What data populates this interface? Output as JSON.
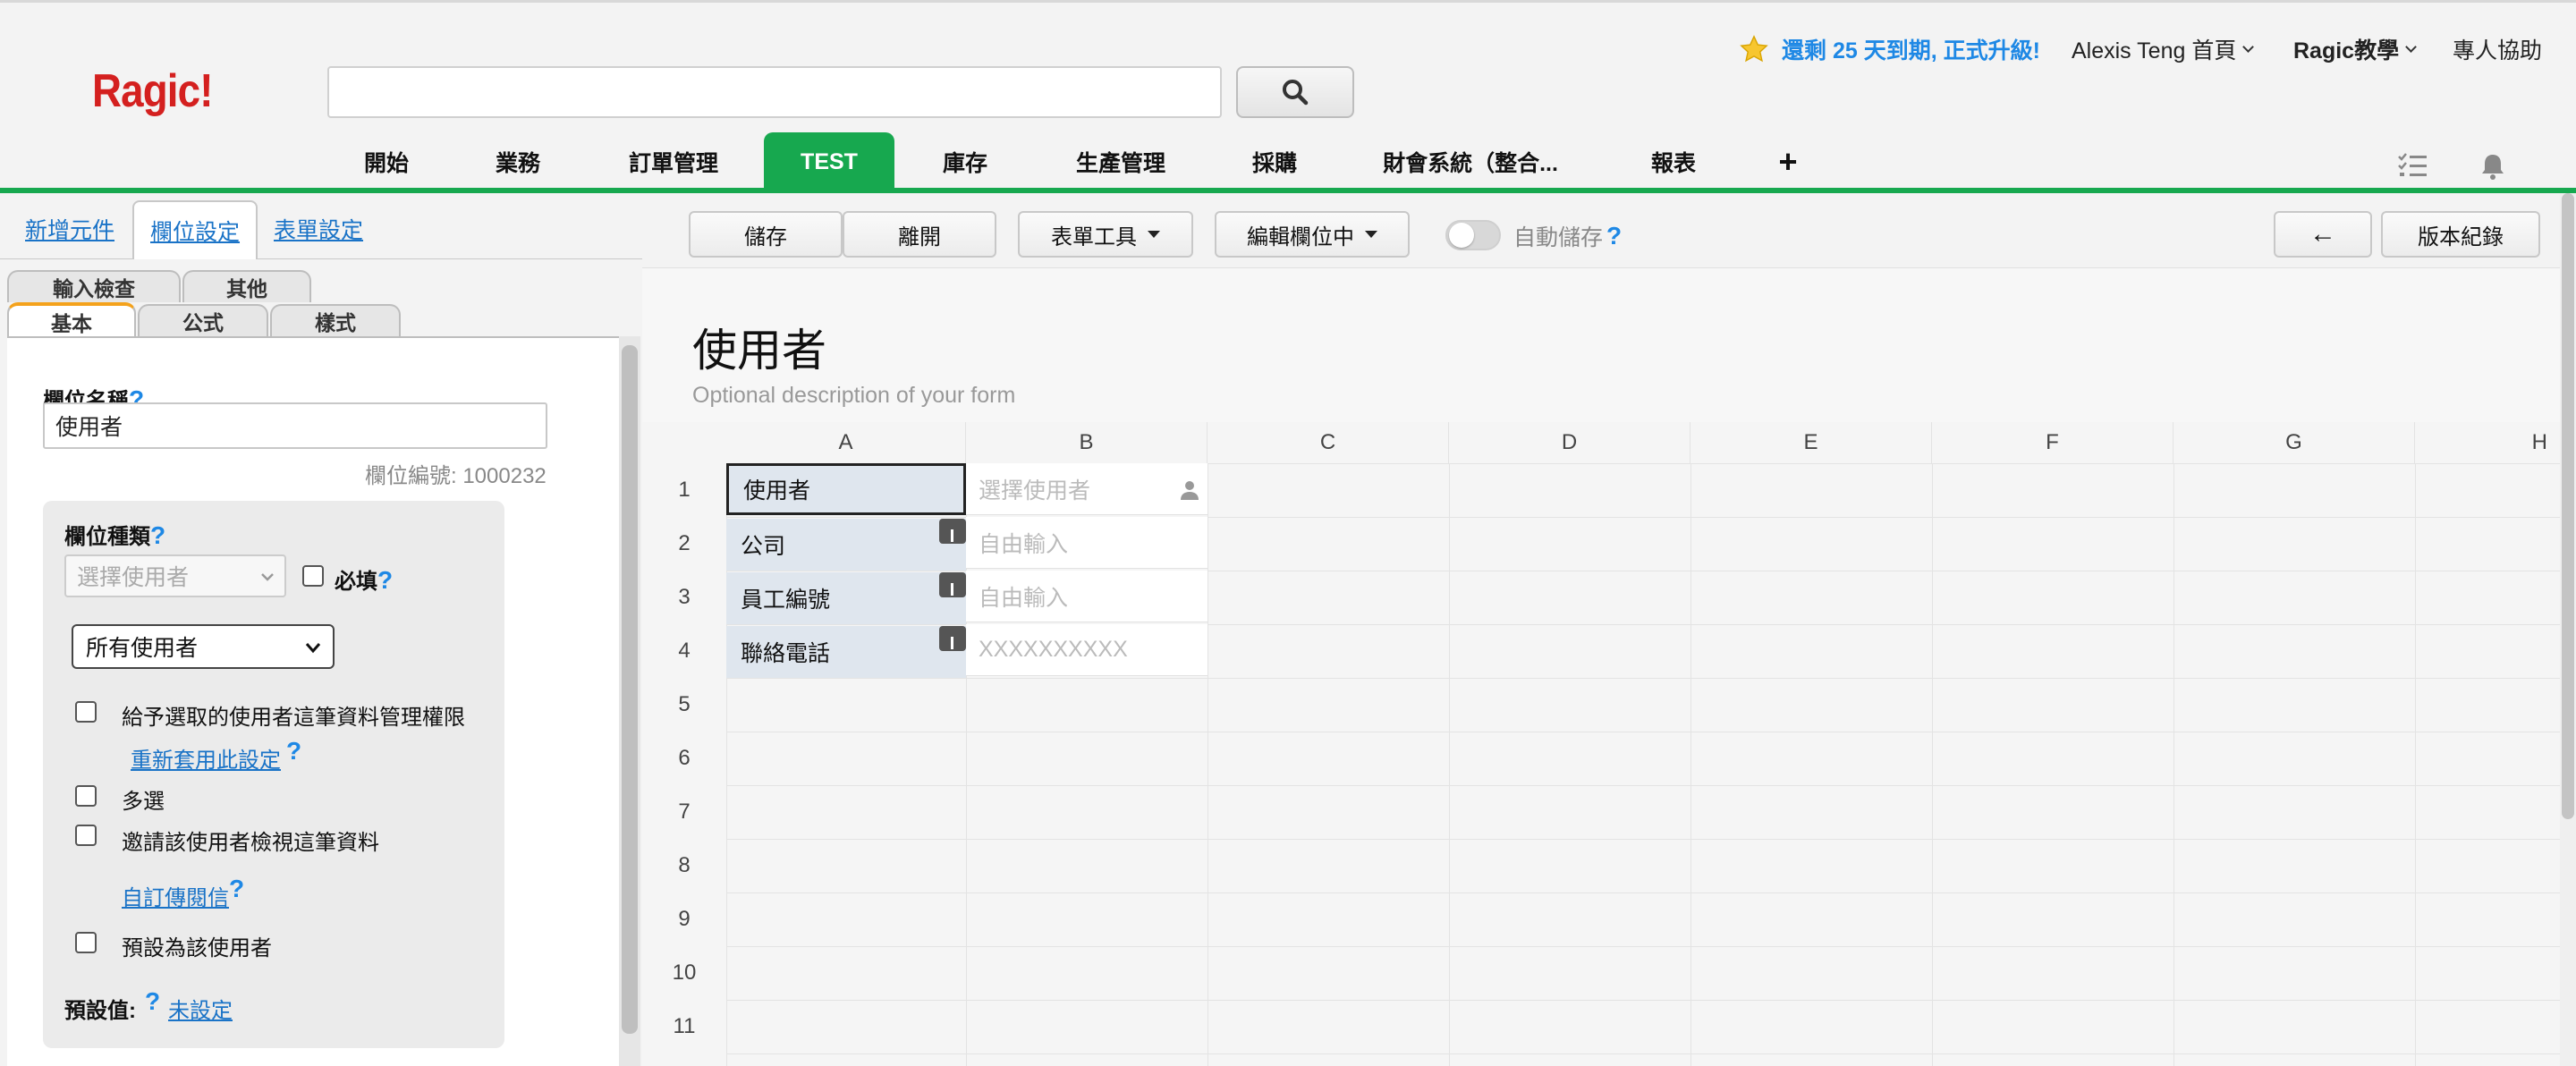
{
  "header": {
    "logo": "Ragic!",
    "upgrade_notice": "還剩 25 天到期, 正式升級!",
    "user_home": "Alexis Teng 首頁",
    "ragic_tutorial": "Ragic教學",
    "pro_help": "專人協助"
  },
  "nav": {
    "tabs": [
      "開始",
      "業務",
      "訂單管理",
      "TEST",
      "庫存",
      "生產管理",
      "採購",
      "財會系統（整合...",
      "報表"
    ],
    "active_tab": "TEST",
    "add": "+"
  },
  "left_panel": {
    "top_tabs": [
      "新增元件",
      "欄位設定",
      "表單設定"
    ],
    "active_top_tab": "欄位設定",
    "sub_tabs_row1": [
      "輸入檢查",
      "其他"
    ],
    "sub_tabs_row2": [
      "基本",
      "公式",
      "樣式"
    ],
    "active_sub_tab": "基本",
    "field_name_label": "欄位名稱",
    "field_name_value": "使用者",
    "field_number": "欄位編號: 1000232",
    "field_type_label": "欄位種類",
    "field_type_value": "選擇使用者",
    "required_label": "必填",
    "user_scope_value": "所有使用者",
    "option_grant_rights": "給予選取的使用者這筆資料管理權限",
    "link_reapply": "重新套用此設定",
    "option_multiple": "多選",
    "option_invite_view": "邀請該使用者檢視這筆資料",
    "link_custom_message": "自訂傳閱信",
    "option_default_user": "預設為該使用者",
    "default_value_label": "預設值:",
    "default_value_link": "未設定"
  },
  "toolbar": {
    "save": "儲存",
    "leave": "離開",
    "form_tools": "表單工具",
    "editing_fields": "編輯欄位中",
    "autosave": "自動儲存",
    "back": "←",
    "version_history": "版本紀錄"
  },
  "form": {
    "title": "使用者",
    "description": "Optional description of your form"
  },
  "sheet": {
    "columns": [
      "A",
      "B",
      "C",
      "D",
      "E",
      "F",
      "G",
      "H"
    ],
    "rows": [
      "1",
      "2",
      "3",
      "4",
      "5",
      "6",
      "7",
      "8",
      "9",
      "10",
      "11"
    ],
    "cells": [
      {
        "label": "使用者",
        "placeholder": "選擇使用者"
      },
      {
        "label": "公司",
        "placeholder": "自由輸入"
      },
      {
        "label": "員工編號",
        "placeholder": "自由輸入"
      },
      {
        "label": "聯絡電話",
        "placeholder": "XXXXXXXXXX"
      }
    ]
  },
  "colors": {
    "brand_green": "#17a84f",
    "logo_red": "#d4201f",
    "link_blue": "#1a73c7",
    "help_blue": "#1e88e5"
  },
  "icons": [
    "search-icon",
    "star-icon",
    "checklist-icon",
    "bell-icon",
    "user-icon",
    "help-icon",
    "chevron-down-icon"
  ]
}
